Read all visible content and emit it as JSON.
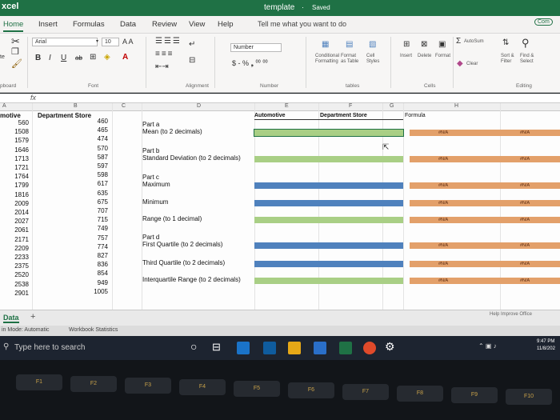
{
  "app_name": "xcel",
  "doc": {
    "title": "template",
    "status": "Saved"
  },
  "tabs": [
    "Home",
    "Insert",
    "Formulas",
    "Data",
    "Review",
    "View",
    "Help"
  ],
  "tell_me": "Tell me what you want to do",
  "comments_label": "Com",
  "ribbon": {
    "font_name": "Arial",
    "font_size": "10",
    "grow_shrink": "A  A",
    "bold": "B",
    "italic": "I",
    "underline": "U",
    "number_format": "Number",
    "number_buttons": "$ - % ❟  ⁰⁰ ⁰⁰",
    "groups": {
      "clipboard": "pboard",
      "font": "Font",
      "alignment": "Alignment",
      "number": "Number",
      "styles": "tables",
      "cells": "Cells",
      "editing": "Editing"
    },
    "cond_format": [
      "Conditional",
      "Formatting"
    ],
    "format_table": [
      "Format",
      "as Table"
    ],
    "cell_styles": [
      "Cell",
      "Styles"
    ],
    "insert": "Insert",
    "delete": "Delete",
    "format": "Format",
    "autosum": "AutoSum",
    "clear": "Clear",
    "sort": [
      "Sort &",
      "Filter"
    ],
    "find": [
      "Find &",
      "Select"
    ],
    "paste_partial": "te"
  },
  "formula_bar": {
    "fx": "fx"
  },
  "columns": [
    "A",
    "B",
    "C",
    "D",
    "E",
    "F",
    "G",
    "H"
  ],
  "headers": {
    "a": "motive",
    "b": "Department Store",
    "e": "Automotive",
    "f": "Department Store",
    "formula": "Formula"
  },
  "col_a": [
    "560",
    "1508",
    "1579",
    "1646",
    "1713",
    "1721",
    "1764",
    "1799",
    "1816",
    "2009",
    "2014",
    "2027",
    "2061",
    "2171",
    "2209",
    "2233",
    "2375",
    "2520",
    "2538",
    "2901"
  ],
  "col_b": [
    "460",
    "465",
    "474",
    "570",
    "587",
    "597",
    "598",
    "617",
    "635",
    "675",
    "707",
    "715",
    "749",
    "757",
    "774",
    "827",
    "836",
    "854",
    "949",
    "1005"
  ],
  "questions": {
    "pa": "Part a",
    "mean": "Mean (to 2 decimals)",
    "pb": "Part b",
    "stdev": "Standard Deviation (to 2 decimals)",
    "pc": "Part c",
    "max": "Maximum",
    "min": "Minimum",
    "range": "Range (to 1 decimal)",
    "pd": "Part d",
    "q1": "First Quartile (to 2 decimals)",
    "q3": "Third Quartile (to 2 decimals)",
    "iqr": "Interquartile Range (to 2 decimals)"
  },
  "na": "#N/A",
  "sheet_tab": "Data",
  "add_sheet": "+",
  "status_bar": {
    "mode": "in Mode: Automatic",
    "stats": "Workbook Statistics"
  },
  "help_improve": "Help Improve Office",
  "taskbar": {
    "search": "Type here to search",
    "time": "9:47 PM",
    "date": "11/8/202"
  },
  "keyboard_keys": [
    "F1",
    "F2",
    "F3",
    "F4",
    "F5",
    "F6",
    "F7",
    "F8",
    "F9",
    "F10"
  ],
  "colors": {
    "excel_green": "#1f7145",
    "input_green": "#a9cf85",
    "output_blue": "#4f81bd",
    "formula_orange": "#e3a06a"
  }
}
